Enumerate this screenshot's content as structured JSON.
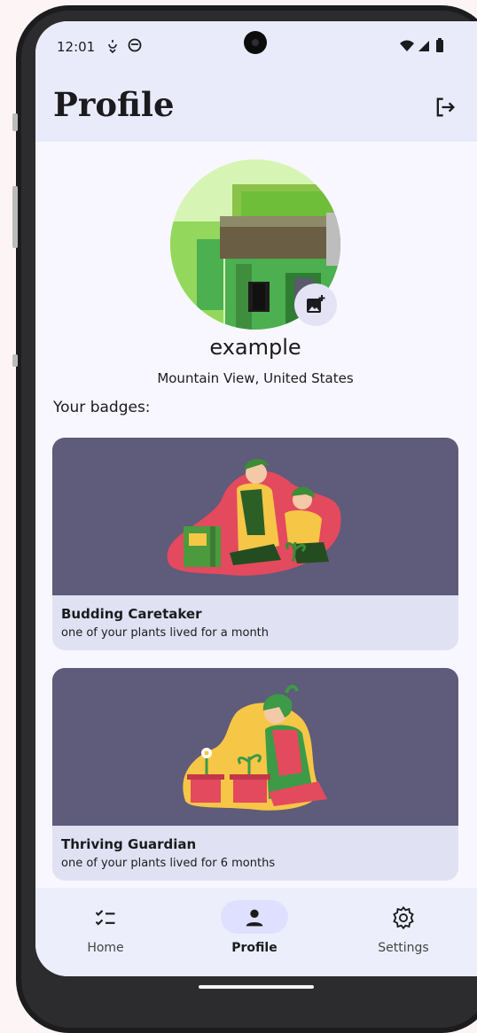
{
  "status_bar": {
    "time": "12:01",
    "icons": [
      "dnd-icon",
      "face-icon",
      "wifi-icon",
      "signal-icon",
      "battery-icon"
    ]
  },
  "header": {
    "title": "Profile",
    "logout_icon": "logout-icon"
  },
  "profile": {
    "username": "example",
    "location": "Mountain View, United States",
    "add_photo_icon": "add-photo-icon"
  },
  "badges": {
    "title": "Your badges:",
    "items": [
      {
        "name": "Budding Caretaker",
        "description": "one of your plants lived for a month"
      },
      {
        "name": "Thriving Guardian",
        "description": "one of your plants lived for 6 months"
      }
    ]
  },
  "nav": {
    "items": [
      {
        "label": "Home",
        "icon": "checklist-icon",
        "active": false
      },
      {
        "label": "Profile",
        "icon": "person-icon",
        "active": true
      },
      {
        "label": "Settings",
        "icon": "gear-icon",
        "active": false
      }
    ]
  },
  "colors": {
    "accent": "#dfe0ff",
    "card_image_bg": "#5e5b7b",
    "card_bg": "#e0e2f3",
    "topbar_bg": "#e9ebfa"
  }
}
